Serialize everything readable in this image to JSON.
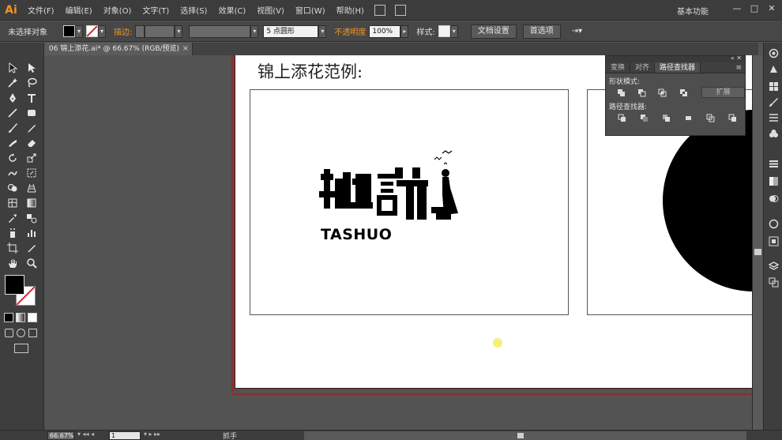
{
  "app": {
    "logo": "Ai",
    "workspace": "基本功能"
  },
  "menu": [
    "文件(F)",
    "编辑(E)",
    "对象(O)",
    "文字(T)",
    "选择(S)",
    "效果(C)",
    "视图(V)",
    "窗口(W)",
    "帮助(H)"
  ],
  "window_buttons": {
    "minimize": "—",
    "maximize": "□",
    "close": "✕"
  },
  "control": {
    "no_selection": "未选择对象",
    "stroke_label": "描边:",
    "brush_value": "5 点圆形",
    "opacity_label": "不透明度",
    "opacity_value": "100%",
    "style_label": "样式:",
    "doc_setup": "文档设置",
    "preferences": "首选项"
  },
  "doc_tab": {
    "title": "06 锦上添花.ai* @ 66.67% (RGB/预览)",
    "close": "×"
  },
  "artboard": {
    "heading": "锦上添花范例:",
    "logo_text": "TASHUO"
  },
  "pathfinder": {
    "tabs": [
      "变换",
      "对齐",
      "路径查找器"
    ],
    "active_tab": "路径查找器",
    "shape_modes_label": "形状模式:",
    "pathfinders_label": "路径查找器:",
    "expand_label": "扩展"
  },
  "status": {
    "zoom": "66.67%",
    "page": "1",
    "tool": "抓手"
  },
  "colors": {
    "accent_orange": "#f7941d",
    "artboard_border": "#8a2c2c",
    "ui_dark": "#3c3c3c"
  }
}
